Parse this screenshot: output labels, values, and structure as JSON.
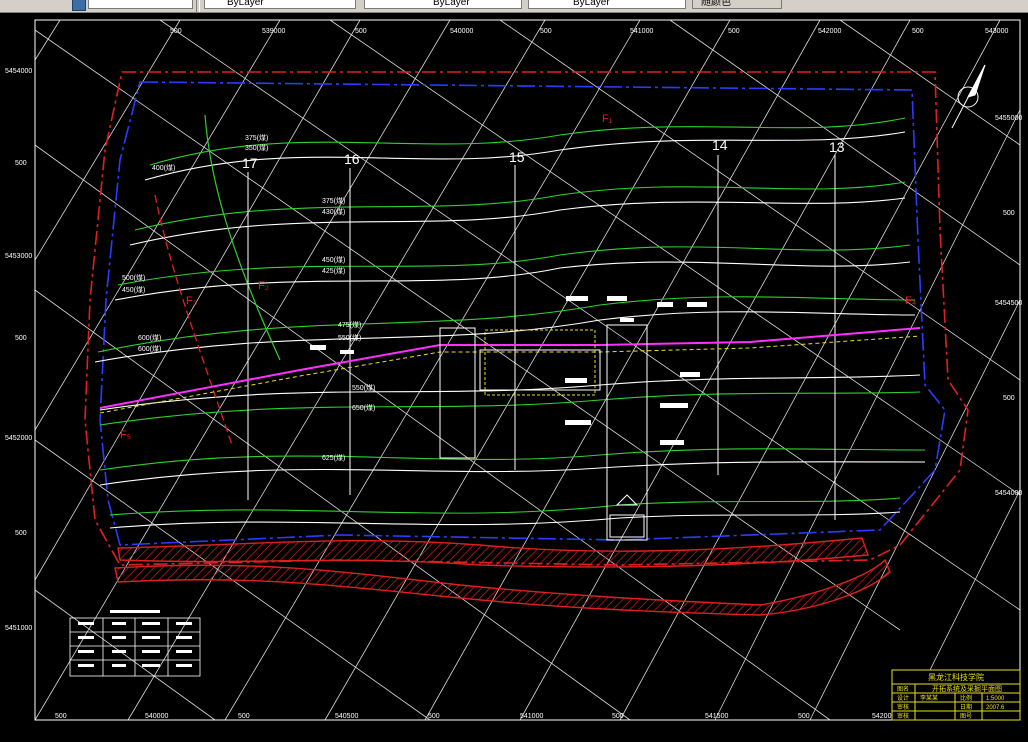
{
  "toolbar": {
    "layer_field": "ByLayer",
    "linetype_field": "ByLayer",
    "lineweight_field": "ByLayer",
    "plotstyle_field": "随颜色"
  },
  "drawing": {
    "top_coords": [
      "500",
      "539000",
      "500",
      "540000",
      "500",
      "541000",
      "500",
      "542000",
      "500",
      "543000"
    ],
    "bottom_coords": [
      "500",
      "540000",
      "500",
      "540500",
      "500",
      "541000",
      "500",
      "541500",
      "500",
      "542000"
    ],
    "left_coords": [
      "5454000",
      "500",
      "5453000",
      "500",
      "5452000",
      "500",
      "5451000"
    ],
    "right_coords": [
      "5455000",
      "500",
      "5454500",
      "500",
      "5454000"
    ],
    "line_numbers": [
      "17",
      "16",
      "15",
      "14",
      "13"
    ],
    "fault_labels": [
      "F₁",
      "F₂",
      "F₃",
      "F₄",
      "F₅"
    ],
    "contour_labels": [
      "375(煤)",
      "350(煤)",
      "400(煤)",
      "375(煤)",
      "430(煤)",
      "450(煤)",
      "425(煤)",
      "500(煤)",
      "450(煤)",
      "475(煤)",
      "550(煤)",
      "600(煤)",
      "600(煤)",
      "550(煤)",
      "650(煤)",
      "625(煤)"
    ]
  },
  "title_block": {
    "institution": "黑龙江科技学院",
    "drawing_title": "开拓系统及采掘平面图",
    "row_labels": [
      "图名",
      "设计",
      "审核",
      "审核"
    ],
    "row_values": [
      "李某某",
      "",
      "",
      ""
    ],
    "col_labels": [
      "比例",
      "日期",
      "图号"
    ],
    "col_values": [
      "1:5000",
      "2007.6",
      ""
    ]
  }
}
